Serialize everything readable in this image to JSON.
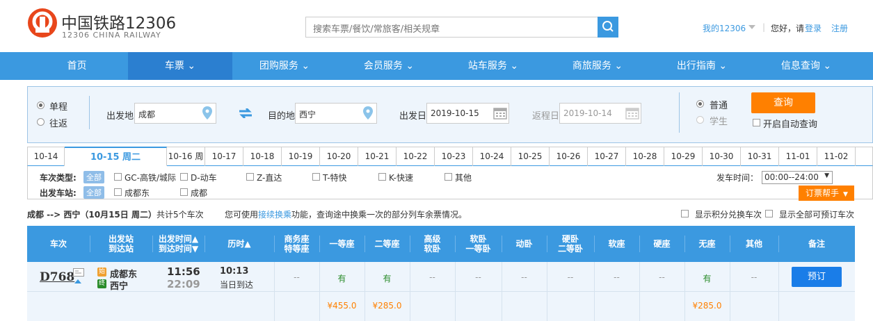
{
  "header": {
    "logo_cn": "中国铁路12306",
    "logo_en": "12306 CHINA RAILWAY",
    "search_placeholder": "搜索车票/餐饮/常旅客/相关规章",
    "my12306": "我的12306",
    "separator": "|",
    "hello": "您好，请",
    "login": "登录",
    "register": "注册"
  },
  "nav": {
    "items": [
      {
        "label": "首页",
        "has_caret": false
      },
      {
        "label": "车票",
        "has_caret": true,
        "active": true
      },
      {
        "label": "团购服务",
        "has_caret": true
      },
      {
        "label": "会员服务",
        "has_caret": true
      },
      {
        "label": "站车服务",
        "has_caret": true
      },
      {
        "label": "商旅服务",
        "has_caret": true
      },
      {
        "label": "出行指南",
        "has_caret": true
      },
      {
        "label": "信息查询",
        "has_caret": true
      }
    ]
  },
  "query": {
    "one_way": "单程",
    "round_trip": "往返",
    "from_label": "出发地",
    "from_value": "成都",
    "to_label": "目的地",
    "to_value": "西宁",
    "depart_label": "出发日",
    "depart_value": "2019-10-15",
    "return_label": "返程日",
    "return_value": "2019-10-14",
    "normal": "普通",
    "student": "学生",
    "query_button": "查询",
    "auto_query": "开启自动查询"
  },
  "dates": [
    "10-14",
    "10-15 周二",
    "10-16 周",
    "10-17",
    "10-18",
    "10-19",
    "10-20",
    "10-21",
    "10-22",
    "10-23",
    "10-24",
    "10-25",
    "10-26",
    "10-27",
    "10-28",
    "10-29",
    "10-30",
    "10-31",
    "11-01",
    "11-02"
  ],
  "filter": {
    "train_type_label": "车次类型:",
    "all": "全部",
    "types": [
      "GC-高铁/城际",
      "D-动车",
      "Z-直达",
      "T-特快",
      "K-快速",
      "其他"
    ],
    "station_label": "出发车站:",
    "stations": [
      "成都东",
      "成都"
    ],
    "time_label": "发车时间：",
    "time_value": "00:00--24:00",
    "helper": "订票帮手"
  },
  "summary": {
    "route": "成都 --> 西宁（10月15日 周二）",
    "count": "共计5个车次",
    "tip_pre": "您可使用",
    "tip_link": "接续换乘",
    "tip_post": "功能，查询途中换乘一次的部分列车余票情况。",
    "opt1": "显示积分兑换车次",
    "opt2": "显示全部可预订车次"
  },
  "table": {
    "headers": [
      [
        "车次"
      ],
      [
        "出发站",
        "到达站"
      ],
      [
        "出发时间▲",
        "到达时间▼"
      ],
      [
        "历时▲"
      ],
      [
        "商务座",
        "特等座"
      ],
      [
        "一等座"
      ],
      [
        "二等座"
      ],
      [
        "高级",
        "软卧"
      ],
      [
        "软卧",
        "一等卧"
      ],
      [
        "动卧"
      ],
      [
        "硬卧",
        "二等卧"
      ],
      [
        "软座"
      ],
      [
        "硬座"
      ],
      [
        "无座"
      ],
      [
        "其他"
      ],
      [
        "备注"
      ]
    ],
    "row": {
      "train": "D768",
      "from_tag": "始",
      "from": "成都东",
      "to_tag": "终",
      "to": "西宁",
      "depart": "11:56",
      "arrive": "22:09",
      "duration": "10:13",
      "arrival_day": "当日到达",
      "seats": [
        "--",
        "有",
        "有",
        "--",
        "--",
        "--",
        "--",
        "--",
        "--",
        "有",
        "--"
      ],
      "book": "预订"
    },
    "prices": [
      "",
      "¥455.0",
      "¥285.0",
      "",
      "",
      "",
      "",
      "",
      "",
      "¥285.0",
      ""
    ]
  },
  "colors": {
    "brand_blue": "#3b99e0",
    "accent_orange": "#ff8000",
    "logo_red": "#e8461b"
  }
}
